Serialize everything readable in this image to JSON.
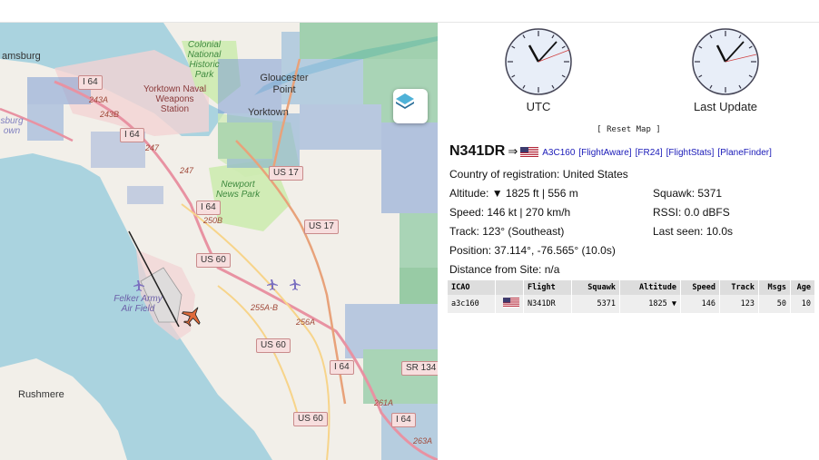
{
  "map": {
    "places": {
      "williamsburg": "amsburg",
      "colonial_park": "Colonial National Historic Park",
      "gloucester_point": "Gloucester Point",
      "yorktown_station": "Yorktown Naval Weapons Station",
      "yorktown": "Yorktown",
      "williamsburg_town": "sburg own",
      "newport_news_park": "Newport News Park",
      "felker": "Felker Army Air Field",
      "rushmere": "Rushmere"
    },
    "shields": {
      "i64_a": "I 64",
      "i64_b": "I 64",
      "i64_c": "I 64",
      "i64_d": "I 64",
      "i64_e": "I 64",
      "us17_a": "US 17",
      "us17_b": "US 17",
      "us60_a": "US 60",
      "us60_b": "US 60",
      "us60_c": "US 60",
      "sr134": "SR 134"
    },
    "road_labels": {
      "r243a": "243A",
      "r243b": "243B",
      "r247a": "247",
      "r247b": "247",
      "r250b": "250B",
      "r255ab": "255A-B",
      "r256a": "256A",
      "r261a": "261A",
      "r263a": "263A"
    },
    "layer_button_icon": "layers-icon",
    "aircraft_icon": "airplane-icon"
  },
  "panel": {
    "clocks": [
      {
        "label": "UTC"
      },
      {
        "label": "Last Update"
      }
    ],
    "reset_map": "[ Reset Map ]",
    "callsign": "N341DR",
    "arrow": "⇒",
    "links": {
      "hex": "A3C160",
      "flightaware": "[FlightAware]",
      "fr24": "[FR24]",
      "flightstats": "[FlightStats]",
      "planefinder": "[PlaneFinder]"
    },
    "country": "Country of registration: United States",
    "altitude": "Altitude: ▼ 1825 ft | 556 m",
    "squawk": "Squawk: 5371",
    "speed": "Speed: 146 kt | 270 km/h",
    "rssi": "RSSI: 0.0 dBFS",
    "track": "Track: 123° (Southeast)",
    "last_seen": "Last seen: 10.0s",
    "position": "Position: 37.114°, -76.565° (10.0s)",
    "distance": "Distance from Site: n/a"
  },
  "table": {
    "headers": [
      "ICAO",
      "",
      "Flight",
      "Squawk",
      "Altitude",
      "Speed",
      "Track",
      "Msgs",
      "Age"
    ],
    "rows": [
      {
        "icao": "a3c160",
        "flag": "us-flag",
        "flight": "N341DR",
        "squawk": "5371",
        "altitude": "1825 ▼",
        "speed": "146",
        "track": "123",
        "msgs": "50",
        "age": "10"
      }
    ]
  },
  "colors": {
    "water": "#aad3df",
    "land": "#f2efe9",
    "park": "#cdebb0",
    "military": "#f2d3d3",
    "link": "#1a1ab8",
    "aircraft": "#e06a3a"
  }
}
